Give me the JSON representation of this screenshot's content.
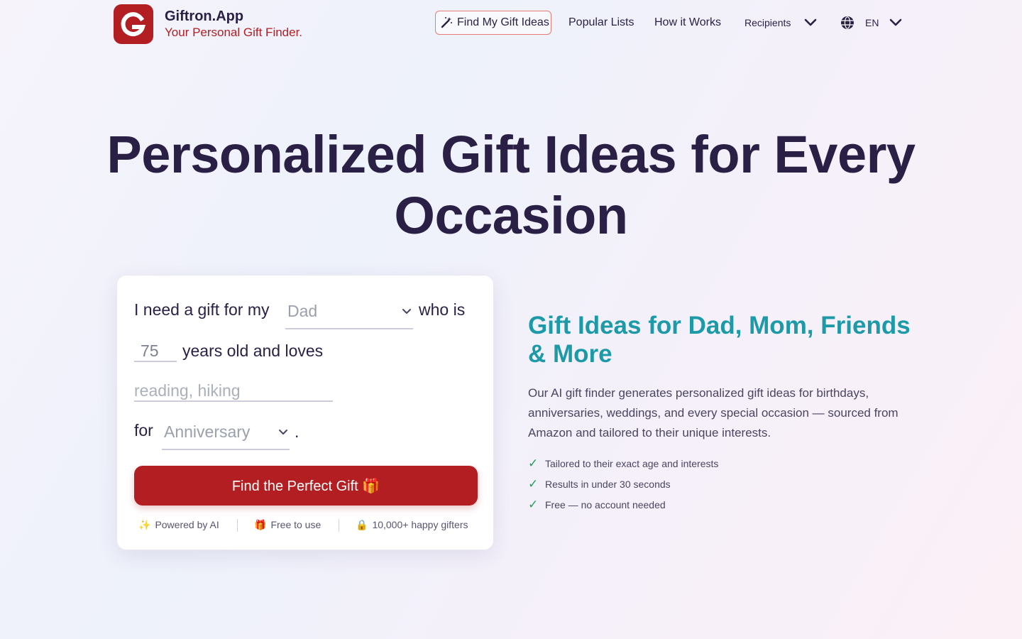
{
  "header": {
    "brand_name": "Giftron.App",
    "brand_tagline": "Your Personal Gift Finder.",
    "nav_cta": "Find My Gift Ideas",
    "nav_popular": "Popular Lists",
    "nav_how": "How it Works",
    "nav_recipients": "Recipients",
    "language": "EN"
  },
  "hero": {
    "title_line1": "Personalized Gift Ideas for Every",
    "title_line2": "Occasion"
  },
  "form": {
    "text_need": "I need a gift for my",
    "recipient_value": "Dad",
    "text_who_is": "who is",
    "age_value": "75",
    "text_years": "years old and loves",
    "interests_placeholder": "reading, hiking",
    "text_for": "for",
    "occasion_value": "Anniversary",
    "text_period": ".",
    "submit_label": "Find the Perfect Gift 🎁",
    "badges": [
      {
        "icon": "✨",
        "label": "Powered by AI"
      },
      {
        "icon": "🎁",
        "label": "Free to use"
      },
      {
        "icon": "🔒",
        "label": "10,000+ happy gifters"
      }
    ]
  },
  "info": {
    "title": "Gift Ideas for Dad, Mom, Friends & More",
    "description": "Our AI gift finder generates personalized gift ideas for birthdays, anniversaries, weddings, and every special occasion — sourced from Amazon and tailored to their unique interests.",
    "checklist": [
      "Tailored to their exact age and interests",
      "Results in under 30 seconds",
      "Free — no account needed"
    ]
  },
  "colors": {
    "brand_red": "#b31e22",
    "heading_dark": "#2a1f45",
    "accent_teal": "#1d9aa8",
    "check_green": "#22a05a"
  }
}
